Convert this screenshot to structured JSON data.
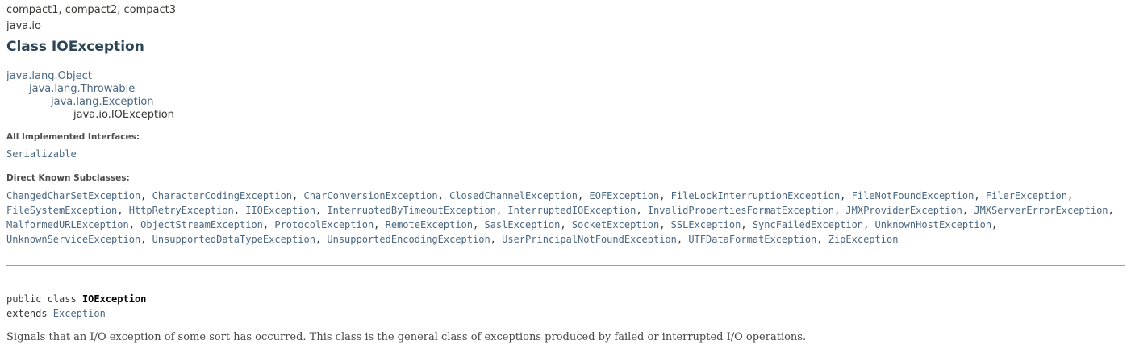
{
  "profiles": "compact1, compact2, compact3",
  "package": "java.io",
  "title": "Class IOException",
  "inheritance": [
    "java.lang.Object",
    "java.lang.Throwable",
    "java.lang.Exception",
    "java.io.IOException"
  ],
  "implemented_label": "All Implemented Interfaces:",
  "interfaces": [
    "Serializable"
  ],
  "subclasses_label": "Direct Known Subclasses:",
  "subclasses": [
    "ChangedCharSetException",
    "CharacterCodingException",
    "CharConversionException",
    "ClosedChannelException",
    "EOFException",
    "FileLockInterruptionException",
    "FileNotFoundException",
    "FilerException",
    "FileSystemException",
    "HttpRetryException",
    "IIOException",
    "InterruptedByTimeoutException",
    "InterruptedIOException",
    "InvalidPropertiesFormatException",
    "JMXProviderException",
    "JMXServerErrorException",
    "MalformedURLException",
    "ObjectStreamException",
    "ProtocolException",
    "RemoteException",
    "SaslException",
    "SocketException",
    "SSLException",
    "SyncFailedException",
    "UnknownHostException",
    "UnknownServiceException",
    "UnsupportedDataTypeException",
    "UnsupportedEncodingException",
    "UserPrincipalNotFoundException",
    "UTFDataFormatException",
    "ZipException"
  ],
  "signature": {
    "modifiers": "public class ",
    "name": "IOException",
    "extends_kw": "extends ",
    "superclass": "Exception"
  },
  "description": "Signals that an I/O exception of some sort has occurred. This class is the general class of exceptions produced by failed or interrupted I/O operations."
}
